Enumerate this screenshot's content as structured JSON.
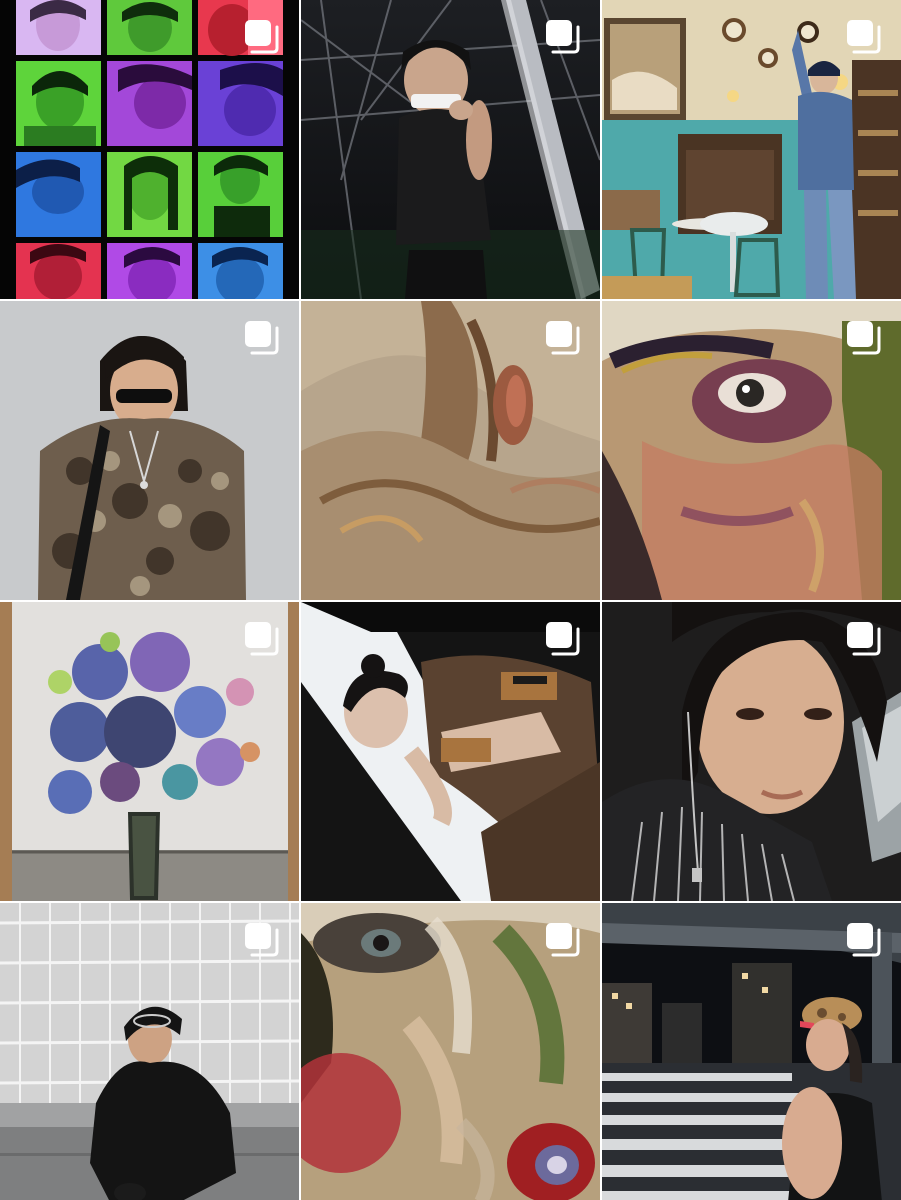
{
  "grid": {
    "posts": [
      {
        "id": "collage",
        "type": "carousel"
      },
      {
        "id": "stage",
        "type": "carousel"
      },
      {
        "id": "antique-shop",
        "type": "carousel"
      },
      {
        "id": "camo-sweater",
        "type": "carousel"
      },
      {
        "id": "painting-hand",
        "type": "carousel"
      },
      {
        "id": "painting-eye",
        "type": "carousel"
      },
      {
        "id": "painting-flowers",
        "type": "carousel"
      },
      {
        "id": "brown-outfit",
        "type": "carousel"
      },
      {
        "id": "selfie-car",
        "type": "carousel"
      },
      {
        "id": "fence-crouch",
        "type": "carousel"
      },
      {
        "id": "painting-face-red",
        "type": "carousel"
      },
      {
        "id": "crosswalk-night",
        "type": "carousel"
      }
    ]
  },
  "icons": {
    "carousel": "multiple-photos-icon"
  },
  "colors": {
    "background": "#ffffff",
    "icon": "#ffffff"
  }
}
